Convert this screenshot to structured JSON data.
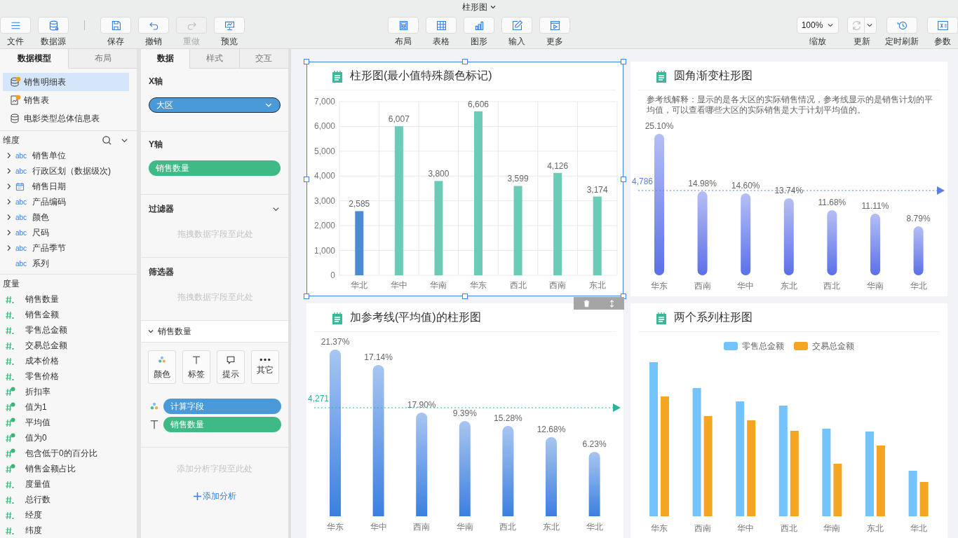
{
  "title": "柱形图",
  "toolbar": {
    "groups": [
      [
        {
          "label": "文件",
          "disabled": false
        },
        {
          "label": "数据源",
          "disabled": false
        }
      ],
      [
        {
          "label": "保存",
          "disabled": false
        },
        {
          "label": "撤销",
          "disabled": false
        },
        {
          "label": "重做",
          "disabled": true
        },
        {
          "label": "预览",
          "disabled": false
        }
      ]
    ],
    "center": [
      {
        "label": "布局"
      },
      {
        "label": "表格"
      },
      {
        "label": "图形"
      },
      {
        "label": "输入"
      },
      {
        "label": "更多"
      }
    ],
    "right": [
      {
        "kind": "zoom",
        "value": "100%",
        "label": "缩放"
      },
      {
        "kind": "split",
        "label": "更新",
        "disabled": true
      },
      {
        "kind": "button",
        "label": "定时刷新"
      },
      {
        "kind": "button",
        "label": "参数"
      }
    ]
  },
  "left_panel": {
    "tabs": [
      {
        "label": "数据模型",
        "selected": true
      },
      {
        "label": "布局",
        "selected": false
      }
    ],
    "tables": [
      {
        "label": "销售明细表",
        "kind": "db",
        "selected": true
      },
      {
        "label": "销售表",
        "kind": "sheet",
        "selected": false
      },
      {
        "label": "电影类型总体信息表",
        "kind": "plain",
        "selected": false
      }
    ],
    "dimensions": {
      "title": "维度",
      "items": [
        {
          "label": "销售单位",
          "kind": "text",
          "type_label": "abc",
          "expandable": true
        },
        {
          "label": "行政区划（数据级次)",
          "kind": "text",
          "type_label": "abc",
          "expandable": true
        },
        {
          "label": "销售日期",
          "kind": "date",
          "expandable": true
        },
        {
          "label": "产品编码",
          "kind": "text",
          "type_label": "abc",
          "expandable": true
        },
        {
          "label": "颜色",
          "kind": "text",
          "type_label": "abc",
          "expandable": true
        },
        {
          "label": "尺码",
          "kind": "text",
          "type_label": "abc",
          "expandable": true
        },
        {
          "label": "产品季节",
          "kind": "text",
          "type_label": "abc",
          "expandable": true
        },
        {
          "label": "系列",
          "kind": "text",
          "type_label": "abc",
          "expandable": false
        }
      ]
    },
    "measures": {
      "title": "度量",
      "items": [
        {
          "label": "销售数量",
          "calculated": false
        },
        {
          "label": "销售金额",
          "calculated": false
        },
        {
          "label": "零售总金额",
          "calculated": false
        },
        {
          "label": "交易总金额",
          "calculated": false
        },
        {
          "label": "成本价格",
          "calculated": false
        },
        {
          "label": "零售价格",
          "calculated": false
        },
        {
          "label": "折扣率",
          "calculated": true
        },
        {
          "label": "值为1",
          "calculated": true
        },
        {
          "label": "平均值",
          "calculated": true
        },
        {
          "label": "值为0",
          "calculated": true
        },
        {
          "label": "包含低于0的百分比",
          "calculated": true
        },
        {
          "label": "销售金额占比",
          "calculated": true
        },
        {
          "label": "度量值",
          "calculated": false
        },
        {
          "label": "总行数",
          "calculated": false
        },
        {
          "label": "经度",
          "calculated": false
        },
        {
          "label": "纬度",
          "calculated": false
        }
      ]
    }
  },
  "config_panel": {
    "tabs": [
      {
        "label": "数据",
        "selected": true
      },
      {
        "label": "样式",
        "selected": false
      },
      {
        "label": "交互",
        "selected": false
      }
    ],
    "x_axis": {
      "title": "X轴",
      "field": {
        "label": "大区",
        "color": "#4a9ad9",
        "hovered": true
      }
    },
    "y_axis": {
      "title": "Y轴",
      "field": {
        "label": "销售数量",
        "color": "#3dba85",
        "hovered": false
      }
    },
    "filter": {
      "title": "过滤器",
      "placeholder": "拖拽数据字段至此处"
    },
    "selector": {
      "title": "筛选器",
      "placeholder": "拖拽数据字段至此处"
    },
    "measure_section": {
      "title": "销售数量",
      "expanded": true,
      "buttons": [
        {
          "label": "颜色"
        },
        {
          "label": "标签"
        },
        {
          "label": "提示"
        },
        {
          "label": "其它"
        }
      ],
      "mappings": [
        {
          "kind": "color",
          "label": "计算字段",
          "color": "#4a9ad9"
        },
        {
          "kind": "label",
          "label": "销售数量",
          "color": "#3dba85"
        }
      ]
    },
    "analysis": {
      "placeholder": "添加分析字段至此处",
      "link": "添加分析"
    }
  },
  "cards": [
    {
      "kind": "axis_bar",
      "title": "柱形图(最小值特殊颜色标记)",
      "selected": true,
      "chart_data": {
        "type": "bar",
        "categories": [
          "华北",
          "华中",
          "华南",
          "华东",
          "西北",
          "西南",
          "东北"
        ],
        "series": [
          {
            "color": "#4a8bd2",
            "values": [
              2585,
              null,
              null,
              null,
              null,
              null,
              null
            ]
          },
          {
            "color": "#6ccbb7",
            "values": [
              null,
              6007,
              3800,
              6606,
              3599,
              4126,
              3174
            ]
          }
        ],
        "grid": true,
        "ylim": [
          0,
          7000
        ],
        "yticks": [
          0,
          {
            "value": 1000,
            "label": "1,000"
          },
          {
            "value": 2000,
            "label": "2,000"
          },
          {
            "value": 3000,
            "label": "3,000"
          },
          {
            "value": 4000,
            "label": "4,000"
          },
          {
            "value": 5000,
            "label": "5,000"
          },
          {
            "value": 6000,
            "label": "6,000"
          },
          {
            "value": 7000,
            "label": "7,000"
          }
        ],
        "value_labels": [
          "2,585",
          "6,007",
          "3,800",
          "6,606",
          "3,599",
          "4,126",
          "3,174"
        ]
      }
    },
    {
      "kind": "rounded_gradient_bar",
      "title": "圆角渐变柱形图",
      "selected": false,
      "description": "参考线解释：显示的是各大区的实际销售情况，参考线显示的是销售计划的平均值，可以查看哪些大区的实际销售是大于计划平均值的。",
      "categories": [
        "华东",
        "西南",
        "华中",
        "东北",
        "西北",
        "华南",
        "华北"
      ],
      "value_labels": [
        "25.10%",
        "14.98%",
        "14.60%",
        "13.74%",
        "11.68%",
        "11.11%",
        "8.79%"
      ],
      "reference_label": "4,786"
    },
    {
      "kind": "reference_bar",
      "title": "加参考线(平均值)的柱形图",
      "selected": false,
      "categories": [
        "华东",
        "华中",
        "西南",
        "华南",
        "西北",
        "东北",
        "华北"
      ],
      "value_labels": [
        "21.37%",
        "17.14%",
        "17.90%",
        "9.39%",
        "15.28%",
        "12.68%",
        "6.23%"
      ],
      "reference_label": "4,271"
    },
    {
      "kind": "grouped_bar",
      "title": "两个系列柱形图",
      "selected": false,
      "legend": [
        {
          "label": "零售总金额",
          "color": "#74c3fc"
        },
        {
          "label": "交易总金额",
          "color": "#f4a522"
        }
      ],
      "categories": [
        "华东",
        "西南",
        "华中",
        "西北",
        "华南",
        "东北",
        "华北"
      ]
    }
  ]
}
